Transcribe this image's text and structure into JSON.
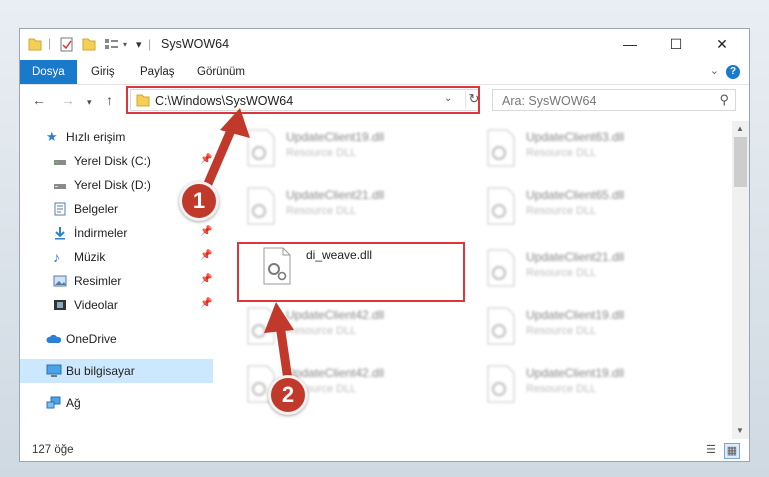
{
  "window": {
    "title": "SysWOW64",
    "minimize_icon": "minimize-icon",
    "maximize_icon": "maximize-icon",
    "close_icon": "close-icon"
  },
  "ribbon": {
    "tabs": [
      {
        "label": "Dosya",
        "active": true
      },
      {
        "label": "Giriş"
      },
      {
        "label": "Paylaş"
      },
      {
        "label": "Görünüm"
      }
    ],
    "help": "?",
    "accent_color": "#1979ca"
  },
  "address": {
    "path": "C:\\Windows\\SysWOW64",
    "search_placeholder": "Ara: SysWOW64"
  },
  "nav": {
    "items": [
      {
        "label": "Hızlı erişim",
        "icon": "star-icon"
      },
      {
        "label": "Yerel Disk (C:)",
        "icon": "drive-icon",
        "pinned": true
      },
      {
        "label": "Yerel Disk (D:)",
        "icon": "drive-icon"
      },
      {
        "label": "Belgeler",
        "icon": "documents-icon",
        "pinned": true
      },
      {
        "label": "İndirmeler",
        "icon": "downloads-icon",
        "pinned": true
      },
      {
        "label": "Müzik",
        "icon": "music-icon",
        "pinned": true
      },
      {
        "label": "Resimler",
        "icon": "pictures-icon",
        "pinned": true
      },
      {
        "label": "Videolar",
        "icon": "videos-icon",
        "pinned": true
      },
      {
        "label": "OneDrive",
        "icon": "cloud-icon"
      },
      {
        "label": "Bu bilgisayar",
        "icon": "computer-icon",
        "selected": true
      },
      {
        "label": "Ağ",
        "icon": "network-icon"
      }
    ]
  },
  "files": [
    {
      "name": "UpdateClient19.dll",
      "type": "Resource DLL"
    },
    {
      "name": "UpdateClient63.dll",
      "type": "Resource DLL"
    },
    {
      "name": "UpdateClient21.dll",
      "type": "Resource DLL"
    },
    {
      "name": "UpdateClient65.dll",
      "type": "Resource DLL"
    },
    {
      "name": "di_weave.dll",
      "type": ""
    },
    {
      "name": "UpdateClient21.dll",
      "type": "Resource DLL"
    },
    {
      "name": "UpdateClient42.dll",
      "type": "Resource DLL"
    },
    {
      "name": "UpdateClient19.dll",
      "type": "Resource DLL"
    },
    {
      "name": "UpdateClient42.dll",
      "type": "Resource DLL"
    },
    {
      "name": "UpdateClient19.dll",
      "type": "Resource DLL"
    }
  ],
  "status": {
    "count": "127 öğe"
  },
  "annotations": {
    "badge1": "1",
    "badge2": "2",
    "color": "#d9363e"
  }
}
